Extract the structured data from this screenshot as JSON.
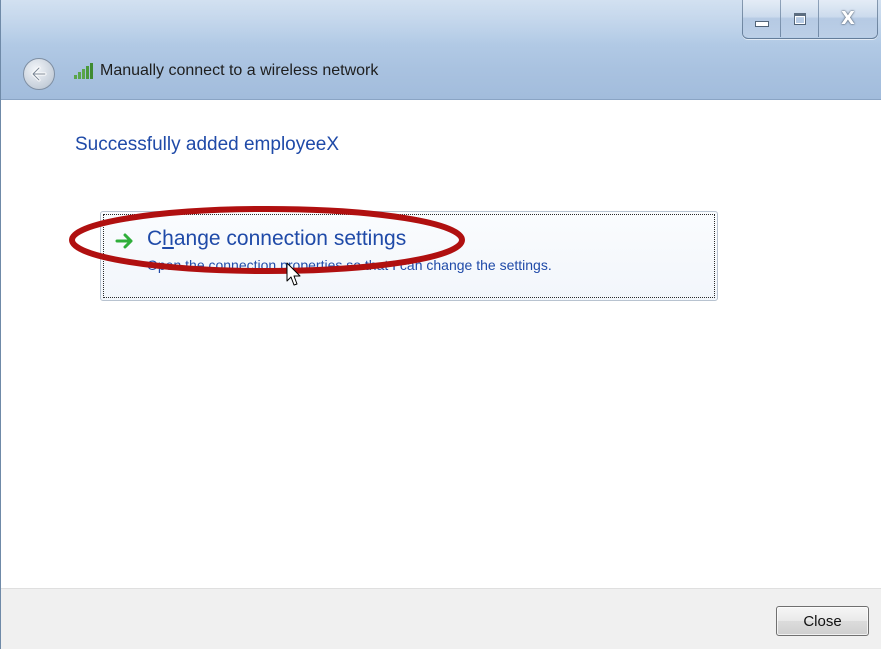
{
  "window": {
    "title": "Manually connect to a wireless network",
    "caption_buttons": {
      "minimize": "minimize-icon",
      "maximize": "maximize-icon",
      "close": "X"
    }
  },
  "content": {
    "heading": "Successfully added employeeX",
    "command_link": {
      "title": "Change connection settings",
      "access_key_letter": "h",
      "description": "Open the connection properties so that I can change the settings."
    }
  },
  "footer": {
    "close_label": "Close"
  },
  "colors": {
    "link_blue": "#1f4aa8",
    "highlight_red": "#b01010",
    "arrow_green": "#2fae3a"
  },
  "icons": {
    "back": "back-arrow-icon",
    "signal": "wireless-signal-icon",
    "command_arrow": "green-arrow-icon",
    "cursor": "mouse-pointer-icon"
  }
}
